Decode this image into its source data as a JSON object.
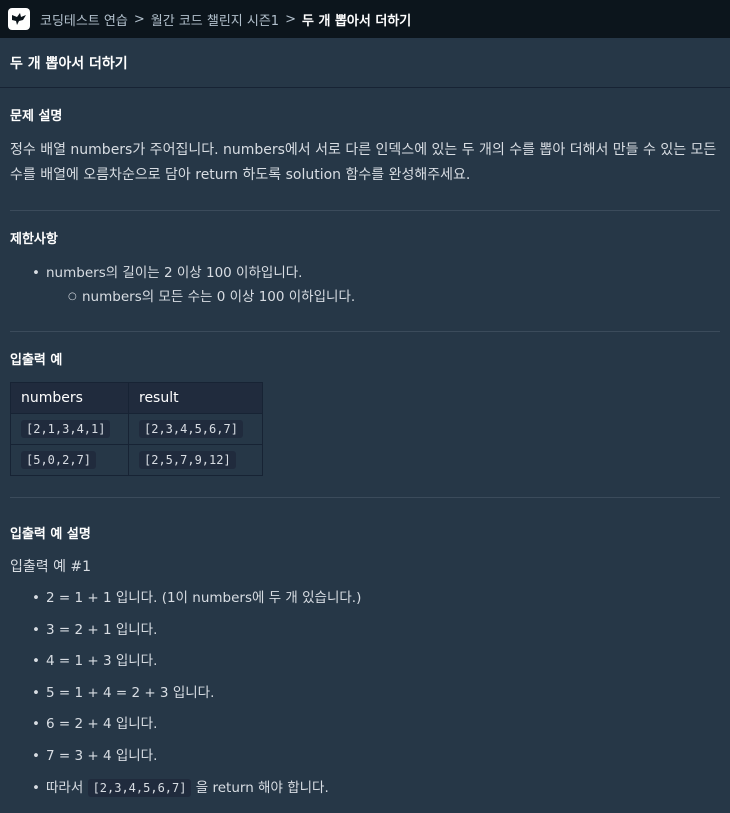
{
  "breadcrumb": {
    "items": [
      "코딩테스트 연습",
      "월간 코드 챌린지 시즌1",
      "두 개 뽑아서 더하기"
    ],
    "separator": ">"
  },
  "page_title": "두 개 뽑아서 더하기",
  "problem": {
    "heading": "문제 설명",
    "description": "정수 배열 numbers가 주어집니다. numbers에서 서로 다른 인덱스에 있는 두 개의 수를 뽑아 더해서 만들 수 있는 모든 수를 배열에 오름차순으로 담아 return 하도록 solution 함수를 완성해주세요."
  },
  "constraints": {
    "heading": "제한사항",
    "items": [
      "numbers의 길이는 2 이상 100 이하입니다.",
      "numbers의 모든 수는 0 이상 100 이하입니다."
    ]
  },
  "io_example": {
    "heading": "입출력 예",
    "columns": [
      "numbers",
      "result"
    ],
    "rows": [
      [
        "[2,1,3,4,1]",
        "[2,3,4,5,6,7]"
      ],
      [
        "[5,0,2,7]",
        "[2,5,7,9,12]"
      ]
    ]
  },
  "io_explanation": {
    "heading": "입출력 예 설명",
    "subheading": "입출력 예 #1",
    "items": [
      "2 = 1 + 1 입니다. (1이 numbers에 두 개 있습니다.)",
      "3 = 2 + 1 입니다.",
      "4 = 1 + 3 입니다.",
      "5 = 1 + 4 = 2 + 3 입니다.",
      "6 = 2 + 4 입니다.",
      "7 = 3 + 4 입니다."
    ],
    "last_prefix": "따라서",
    "last_code": "[2,3,4,5,6,7]",
    "last_suffix": "을 return 해야 합니다."
  }
}
